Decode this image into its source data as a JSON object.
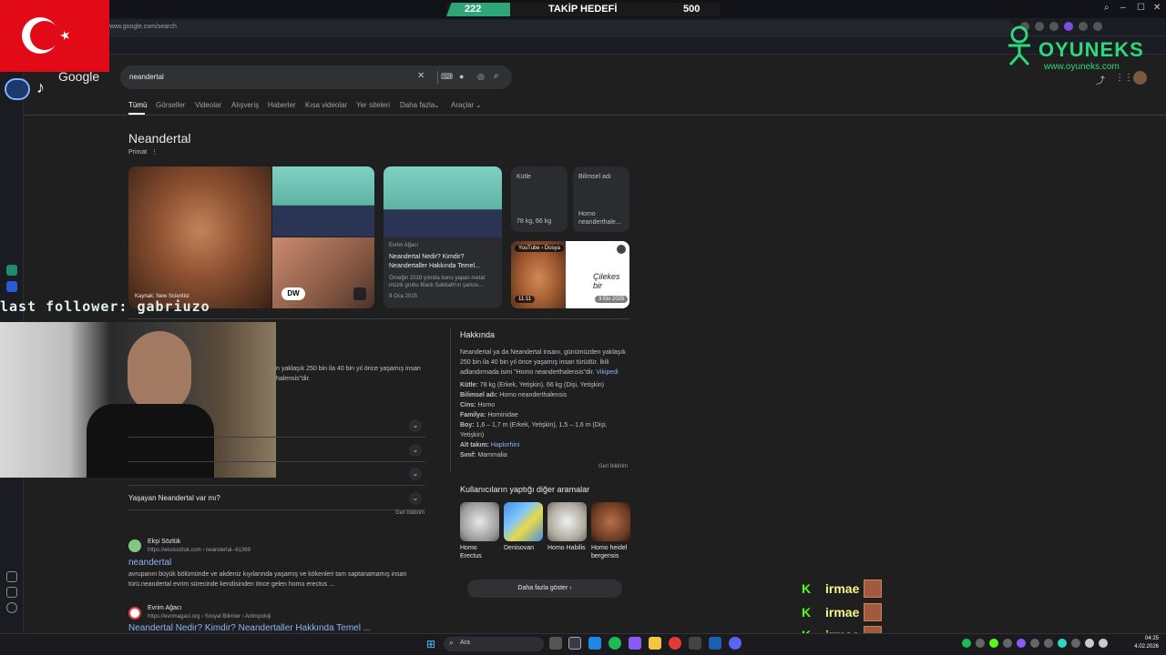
{
  "browser": {
    "url": "www.google.com/search",
    "search_query": "neandertal"
  },
  "goal_widget": {
    "current": "222",
    "label": "TAKİP HEDEFİ",
    "target": "500",
    "progress_fraction": 0.444
  },
  "overlay": {
    "brand": "OYUNEKS",
    "brand_url": "www.oyuneks.com",
    "last_follower": "last follower: gabriuzo",
    "chat": [
      {
        "platform": "K",
        "user": "irmae"
      },
      {
        "platform": "K",
        "user": "irmae"
      },
      {
        "platform": "K",
        "user": "irmae"
      }
    ]
  },
  "google": {
    "logo": "Google",
    "tabs": [
      "Tümü",
      "Görseller",
      "Videolar",
      "Alışveriş",
      "Haberler",
      "Kısa videolar",
      "Yer siteleri",
      "Daha fazla",
      "Araçlar"
    ],
    "entity_title": "Neandertal",
    "entity_subtitle": "Primat",
    "image_caption": "Kaynak: New Scientist",
    "article_card": {
      "source": "Evrim Ağacı",
      "title": "Neandertal Nedir? Kimdir? Neandertaller Hakkında Temel...",
      "snippet": "Örneğin 2018 yılında bunu yapan metal müzik grubu Black Sabbath'ın şarkısı...",
      "date": "9 Oca 2015"
    },
    "video_card": {
      "source": "YouTube › Dosya",
      "duration": "11:11",
      "date": "3 Eki 2025",
      "handwriting": "Çilekes bir"
    },
    "fact_cards": [
      {
        "label": "Kütle",
        "value": "78 kg, 66 kg"
      },
      {
        "label": "Bilimsel adı",
        "value": "Homo neanderthale..."
      }
    ],
    "partial_description": "n yaklaşık 250 bin ila 40 bin yıl önce yaşamış insan",
    "partial_description_2": "halensis\"dir.",
    "faqs": [
      "",
      "",
      "",
      "Yaşayan Neandertal var mı?"
    ],
    "feedback": "Geri bildirim",
    "results": [
      {
        "site": "Ekşi Sözlük",
        "url": "https://eksisozluk.com › neandertal--61369",
        "title": "neandertal",
        "snippet_1": "avrupanın büyük bölümünde ve akdeniz kıyılarında yaşamış ve kökenleri tam saptanamamış insan",
        "snippet_2": "türü.neandertal evrim sürecinde kendisinden önce gelen homo erectus ..."
      },
      {
        "site": "Evrim Ağacı",
        "url": "https://evrimagaci.org › Sosyal Bilimler › Antropoloji",
        "title": "Neandertal Nedir? Kimdir? Neandertaller Hakkında Temel ..."
      }
    ],
    "about": {
      "heading": "Hakkında",
      "text": "Neandertal ya da Neandertal insanı, günümüzden yaklaşık 250 bin ila 40 bin yıl önce yaşamış insan türüdür. İkili adlandırmada ismi \"Homo neanderthalensis\"dir.",
      "source_link": "Vikipedi",
      "facts": [
        {
          "key": "Kütle:",
          "value": "78 kg (Erkek, Yetişkin), 66 kg (Dişi, Yetişkin)"
        },
        {
          "key": "Bilimsel adı:",
          "value": "Homo neanderthalensis"
        },
        {
          "key": "Cins:",
          "value": "Homo"
        },
        {
          "key": "Familya:",
          "value": "Hominidae"
        },
        {
          "key": "Boy:",
          "value": "1,6 – 1,7 m (Erkek, Yetişkin), 1,5 – 1,6 m (Dişi, Yetişkin)"
        },
        {
          "key": "Alt takım:",
          "value": "Haplorhini"
        },
        {
          "key": "Sınıf:",
          "value": "Mammalia"
        }
      ],
      "feedback": "Geri bildirim"
    },
    "related": {
      "heading": "Kullanıcıların yaptığı diğer aramalar",
      "items": [
        "Homo Erectus",
        "Denisovan",
        "Homo Habilis",
        "Homo heidelbergensis"
      ],
      "more_button": "Daha fazla göster"
    }
  },
  "taskbar": {
    "search_placeholder": "Ara",
    "time": "04:25",
    "date": "4.02.2026"
  },
  "colors": {
    "accent_green": "#2fa678",
    "link_blue": "#8ab4f8",
    "kick_green": "#53fc18"
  }
}
